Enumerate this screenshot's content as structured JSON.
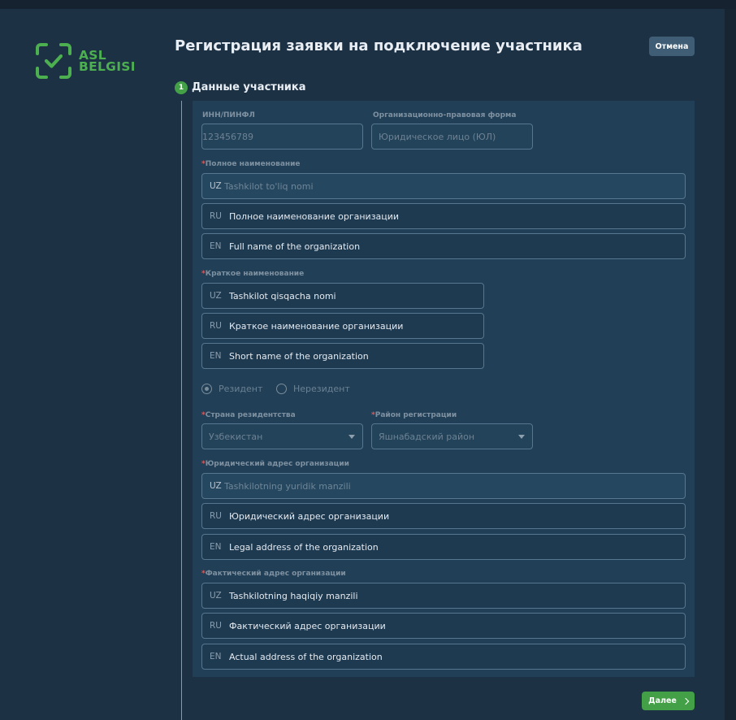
{
  "app": {
    "logo_line1": "ASL",
    "logo_line2": "BELGISI",
    "title": "Регистрация заявки на подключение участника",
    "cancel_label": "Отмена",
    "next_label": "Далее"
  },
  "step": {
    "number": "1",
    "title": "Данные участника"
  },
  "form": {
    "inn": {
      "label": "ИНН/ПИНФЛ",
      "value": "123456789"
    },
    "org_form": {
      "label": "Организационно-правовая форма",
      "value": "Юридическое лицо (ЮЛ)"
    },
    "full_name": {
      "label": "Полное наименование",
      "uz": {
        "lang": "UZ",
        "value": "Tashkilot to'liq nomi"
      },
      "ru": {
        "lang": "RU",
        "value": "Полное наименование организации"
      },
      "en": {
        "lang": "EN",
        "value": "Full name of the organization"
      }
    },
    "short_name": {
      "label": "Краткое наименование",
      "uz": {
        "lang": "UZ",
        "value": "Tashkilot qisqacha nomi"
      },
      "ru": {
        "lang": "RU",
        "value": "Краткое наименование организации"
      },
      "en": {
        "lang": "EN",
        "value": "Short name of the organization"
      }
    },
    "residency": {
      "resident": "Резидент",
      "nonresident": "Нерезидент",
      "selected": "Резидент"
    },
    "country": {
      "label": "Страна резидентства",
      "value": "Узбекистан"
    },
    "district": {
      "label": "Район регистрации",
      "value": "Яшнабадский район"
    },
    "legal_address": {
      "label": "Юридический адрес организации",
      "uz": {
        "lang": "UZ",
        "value": "Tashkilotning yuridik manzili"
      },
      "ru": {
        "lang": "RU",
        "value": "Юридический адрес организации"
      },
      "en": {
        "lang": "EN",
        "value": "Legal address of the organization"
      }
    },
    "actual_address": {
      "label": "Фактический адрес организации",
      "uz": {
        "lang": "UZ",
        "value": "Tashkilotning haqiqiy manzili"
      },
      "ru": {
        "lang": "RU",
        "value": "Фактический адрес организации"
      },
      "en": {
        "lang": "EN",
        "value": "Actual address of the organization"
      }
    }
  },
  "colors": {
    "accent": "#43a047",
    "cancel": "#3f5d75",
    "panel": "#214058",
    "background": "#1d3145",
    "required": "#e05a5a"
  }
}
